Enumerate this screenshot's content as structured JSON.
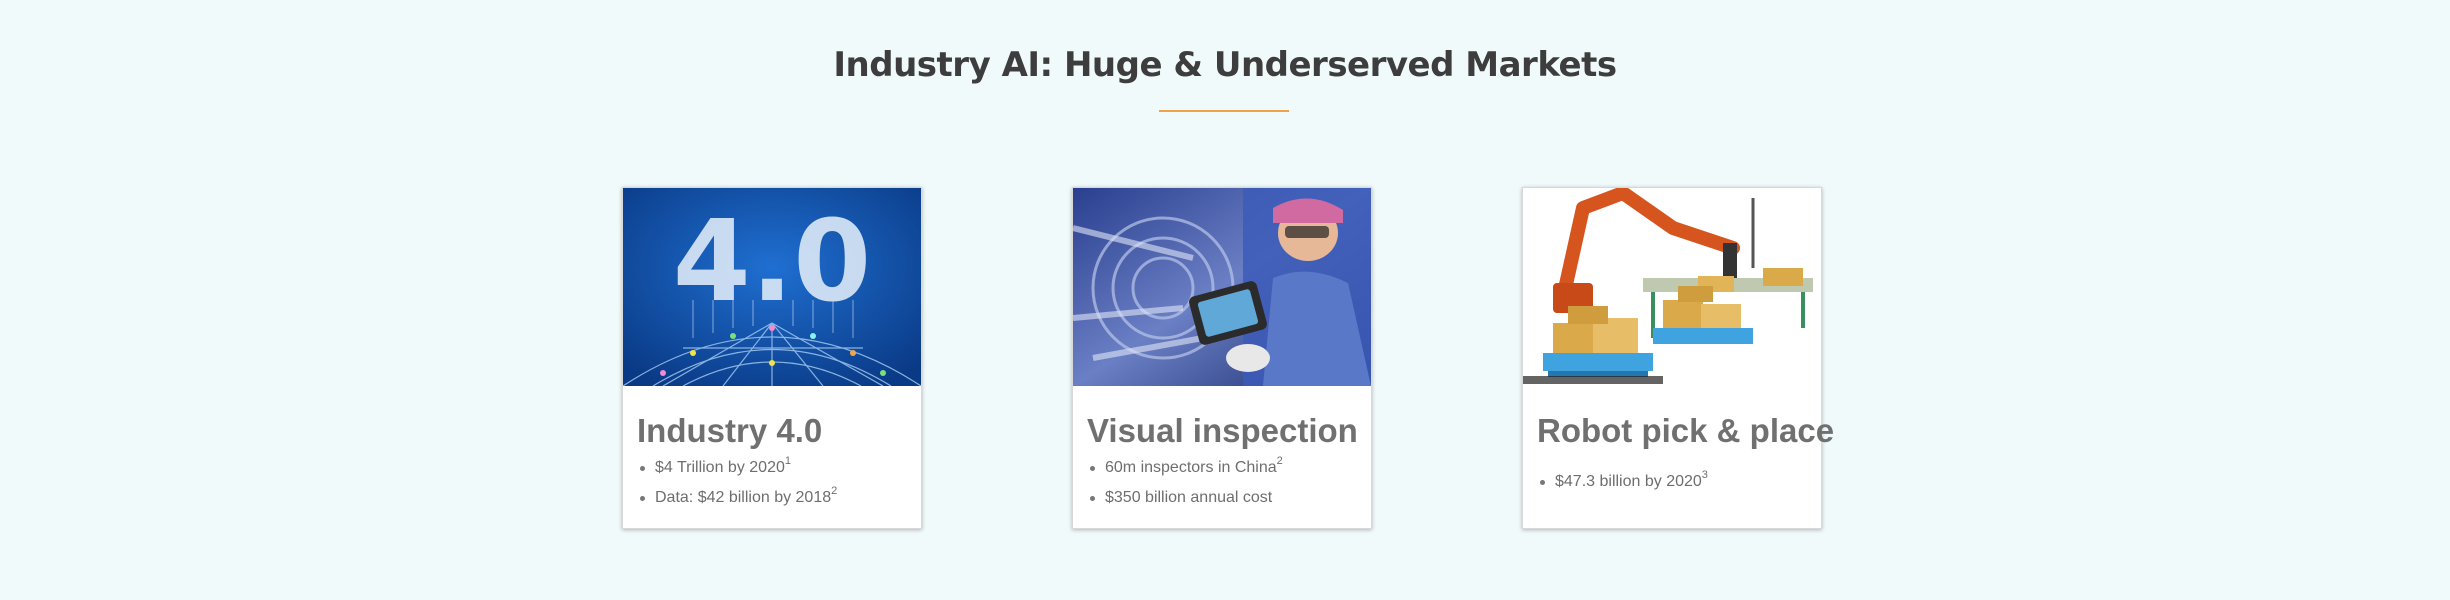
{
  "section": {
    "title": "Industry AI: Huge & Underserved Markets",
    "accent_color": "#f0a24a"
  },
  "cards": [
    {
      "title": "Industry 4.0",
      "image_icon": "industry-4-0-globe-image",
      "image_text": "4.0",
      "items": [
        {
          "text": "$4 Trillion by 2020",
          "ref": "1"
        },
        {
          "text": "Data: $42 billion by 2018",
          "ref": "2"
        }
      ]
    },
    {
      "title": "Visual inspection",
      "image_icon": "engine-inspection-photo",
      "items": [
        {
          "text": "60m inspectors in China",
          "ref": "2"
        },
        {
          "text": "$350 billion annual cost",
          "ref": ""
        }
      ]
    },
    {
      "title": "Robot pick & place",
      "image_icon": "robot-arm-palletizing-photo",
      "items": [
        {
          "text": "$47.3 billion by 2020",
          "ref": "3"
        }
      ]
    }
  ]
}
